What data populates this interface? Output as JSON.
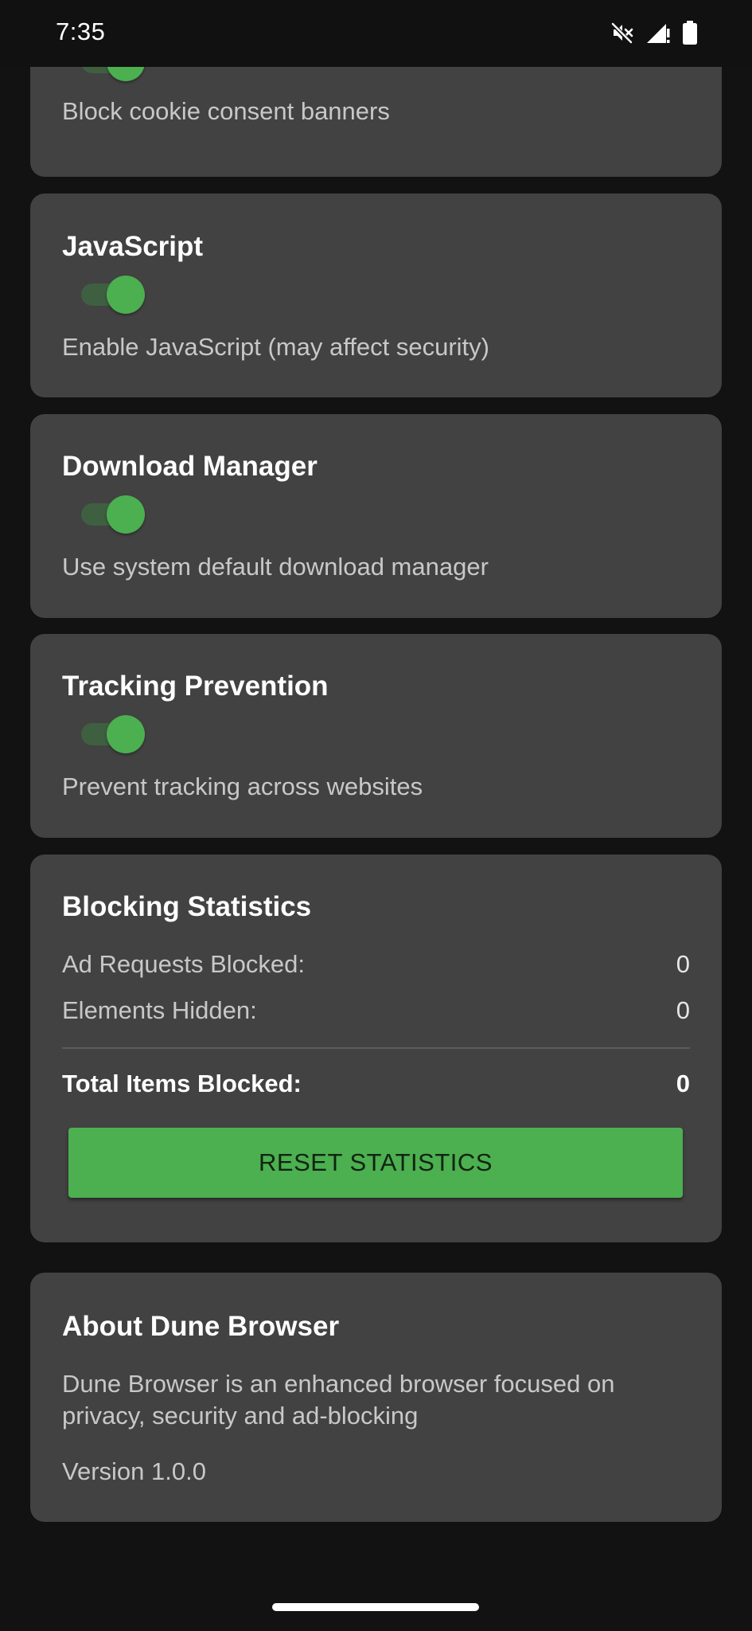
{
  "status_bar": {
    "time": "7:35",
    "icons": [
      "mute-icon",
      "signal-icon",
      "battery-icon"
    ]
  },
  "colors": {
    "background": "#121212",
    "card": "#424242",
    "accent": "#4caf50"
  },
  "settings": {
    "cookie": {
      "desc": "Block cookie consent banners",
      "enabled": true
    },
    "javascript": {
      "title": "JavaScript",
      "desc": "Enable JavaScript (may affect security)",
      "enabled": true
    },
    "download": {
      "title": "Download Manager",
      "desc": "Use system default download manager",
      "enabled": true
    },
    "tracking": {
      "title": "Tracking Prevention",
      "desc": "Prevent tracking across websites",
      "enabled": true
    }
  },
  "stats": {
    "title": "Blocking Statistics",
    "ad_label": "Ad Requests Blocked:",
    "ad_value": "0",
    "elements_label": "Elements Hidden:",
    "elements_value": "0",
    "total_label": "Total Items Blocked:",
    "total_value": "0",
    "reset_label": "RESET STATISTICS"
  },
  "about": {
    "title": "About Dune Browser",
    "desc_line1": "Dune Browser is an enhanced browser focused on",
    "desc_line2": "privacy, security and ad-blocking",
    "version": "Version 1.0.0"
  }
}
